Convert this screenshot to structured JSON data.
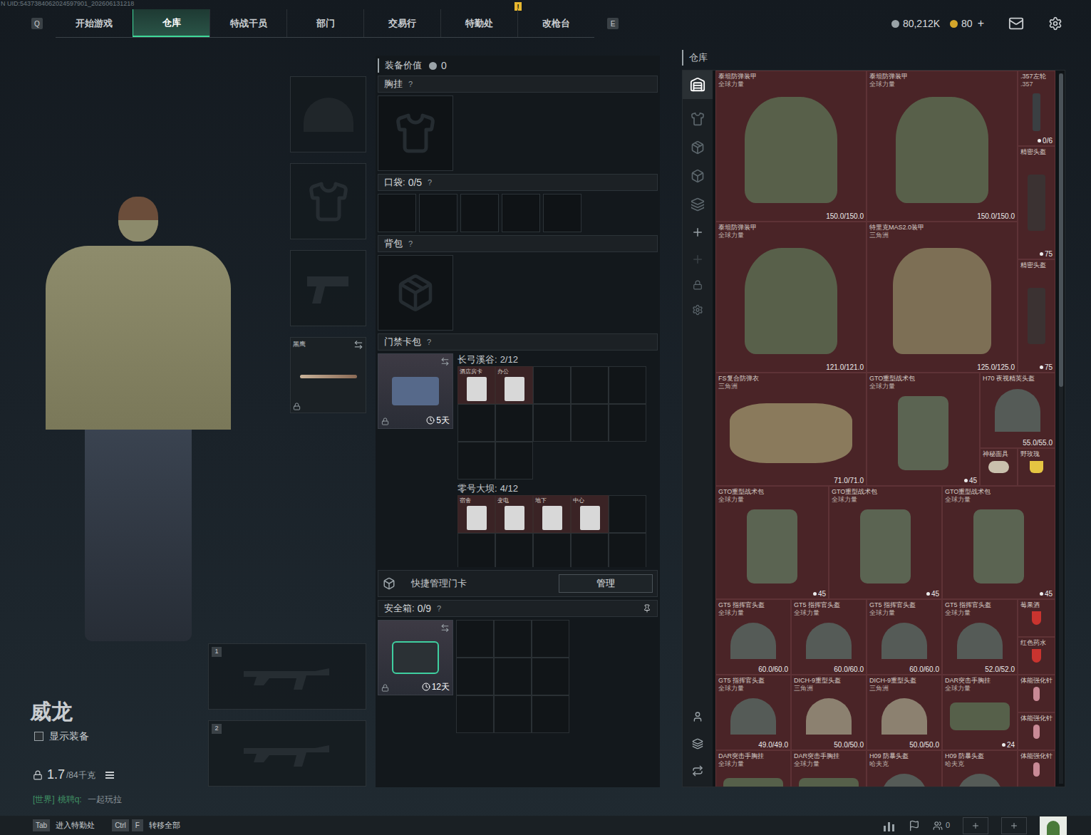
{
  "top_bar": {
    "uid": "N UID:5437384062024597901_202606131218",
    "prev_key": "Q",
    "next_key": "E",
    "tabs": [
      {
        "label": "开始游戏",
        "selected": false,
        "badge": ""
      },
      {
        "label": "仓库",
        "selected": true,
        "badge": ""
      },
      {
        "label": "特战干员",
        "selected": false,
        "badge": ""
      },
      {
        "label": "部门",
        "selected": false,
        "badge": ""
      },
      {
        "label": "交易行",
        "selected": false,
        "badge": ""
      },
      {
        "label": "特勤处",
        "selected": false,
        "badge": "!"
      },
      {
        "label": "改枪台",
        "selected": false,
        "badge": ""
      }
    ],
    "currency": "80,212K",
    "coins": "80",
    "coins_add": "+"
  },
  "character": {
    "name": "威龙",
    "show_equipment": {
      "label": "显示装备",
      "checked": false
    },
    "weight": "1.7",
    "weight_max": "/84千克"
  },
  "chat": {
    "channel": "[世界]",
    "user": "桃聘q:",
    "message": "一起玩拉"
  },
  "gear_slots": {
    "melee_label": "黑鹰",
    "weapon_slots": [
      "1",
      "2"
    ]
  },
  "loadout": {
    "value_label": "装备价值",
    "value": "0",
    "chest": {
      "label": "胸挂",
      "help": "?"
    },
    "pockets": {
      "label": "口袋:",
      "count": "0/5",
      "help": "?",
      "slots": 5
    },
    "backpack": {
      "label": "背包",
      "help": "?"
    },
    "keycards": {
      "label": "门禁卡包",
      "help": "?",
      "case_days": "5天",
      "maps": [
        {
          "name": "长弓溪谷:",
          "count": "2/12",
          "slots": 12,
          "cards": [
            "酒店房卡",
            "办公"
          ]
        },
        {
          "name": "零号大坝:",
          "count": "4/12",
          "slots": 12,
          "cards": [
            "宿舍",
            "变电",
            "地下",
            "中心"
          ]
        }
      ],
      "quick_manage": "快捷管理门卡",
      "manage_button": "管理"
    },
    "safebox": {
      "label": "安全箱:",
      "count": "0/9",
      "help": "?",
      "days": "12天",
      "slots": 9
    }
  },
  "warehouse": {
    "title": "仓库",
    "items": [
      {
        "name": "泰坦防弹装甲",
        "source": "全球力量",
        "durability": "150.0/150.0",
        "badge": "",
        "kind": "armor"
      },
      {
        "name": "泰坦防弹装甲",
        "source": "全球力量",
        "durability": "150.0/150.0",
        "badge": "",
        "kind": "armor"
      },
      {
        "name": ".357左轮",
        "source": ".357",
        "durability": "",
        "badge": "0/6",
        "kind": "revolver"
      },
      {
        "name": "精密头盔",
        "source": "",
        "durability": "",
        "badge": "75",
        "kind": "device"
      },
      {
        "name": "泰坦防弹装甲",
        "source": "全球力量",
        "durability": "121.0/121.0",
        "badge": "",
        "kind": "armor"
      },
      {
        "name": "特里克MAS2.0装甲",
        "source": "三角洲",
        "durability": "125.0/125.0",
        "badge": "",
        "kind": "vest"
      },
      {
        "name": "精密头盔",
        "source": "",
        "durability": "",
        "badge": "75",
        "kind": "device"
      },
      {
        "name": "FS复合防弹衣",
        "source": "三角洲",
        "durability": "71.0/71.0",
        "badge": "",
        "kind": "carrier"
      },
      {
        "name": "GTO重型战术包",
        "source": "全球力量",
        "durability": "",
        "badge": "45",
        "kind": "bag"
      },
      {
        "name": "H70 夜视精英头盔",
        "source": "",
        "durability": "55.0/55.0",
        "badge": "",
        "kind": "helmet"
      },
      {
        "name": "神秘面具",
        "source": "",
        "durability": "",
        "badge": "",
        "kind": "mask"
      },
      {
        "name": "野玫瑰",
        "source": "",
        "durability": "",
        "badge": "",
        "kind": "cocktail"
      },
      {
        "name": "GTO重型战术包",
        "source": "全球力量",
        "durability": "",
        "badge": "45",
        "kind": "bag"
      },
      {
        "name": "GTO重型战术包",
        "source": "全球力量",
        "durability": "",
        "badge": "45",
        "kind": "bag"
      },
      {
        "name": "GTO重型战术包",
        "source": "全球力量",
        "durability": "",
        "badge": "45",
        "kind": "bag"
      },
      {
        "name": "GT5 指挥官头盔",
        "source": "全球力量",
        "durability": "60.0/60.0",
        "badge": "",
        "kind": "helmet"
      },
      {
        "name": "GT5 指挥官头盔",
        "source": "全球力量",
        "durability": "60.0/60.0",
        "badge": "",
        "kind": "helmet"
      },
      {
        "name": "GT5 指挥官头盔",
        "source": "全球力量",
        "durability": "60.0/60.0",
        "badge": "",
        "kind": "helmet"
      },
      {
        "name": "GT5 指挥官头盔",
        "source": "全球力量",
        "durability": "52.0/52.0",
        "badge": "",
        "kind": "helmet"
      },
      {
        "name": "莓果酒",
        "source": "",
        "durability": "",
        "badge": "",
        "kind": "drink"
      },
      {
        "name": "红色药水",
        "source": "",
        "durability": "",
        "badge": "",
        "kind": "drink"
      },
      {
        "name": "GT5 指挥官头盔",
        "source": "全球力量",
        "durability": "49.0/49.0",
        "badge": "",
        "kind": "helmet"
      },
      {
        "name": "DICH-9重型头盔",
        "source": "三角洲",
        "durability": "50.0/50.0",
        "badge": "",
        "kind": "helmet_tan"
      },
      {
        "name": "DICH-9重型头盔",
        "source": "三角洲",
        "durability": "50.0/50.0",
        "badge": "",
        "kind": "helmet_tan"
      },
      {
        "name": "DAR突击手胸挂",
        "source": "全球力量",
        "durability": "",
        "badge": "24",
        "kind": "rig"
      },
      {
        "name": "体能强化针",
        "source": "",
        "durability": "",
        "badge": "",
        "kind": "injector"
      },
      {
        "name": "体能强化针",
        "source": "",
        "durability": "",
        "badge": "",
        "kind": "injector"
      },
      {
        "name": "DAR突击手胸挂",
        "source": "全球力量",
        "durability": "",
        "badge": "",
        "kind": "rig"
      },
      {
        "name": "DAR突击手胸挂",
        "source": "全球力量",
        "durability": "",
        "badge": "",
        "kind": "rig"
      },
      {
        "name": "H09 防暴头盔",
        "source": "哈夫克",
        "durability": "",
        "badge": "",
        "kind": "helmet"
      },
      {
        "name": "H09 防暴头盔",
        "source": "哈夫克",
        "durability": "",
        "badge": "",
        "kind": "helmet"
      },
      {
        "name": "体能强化针",
        "source": "",
        "durability": "",
        "badge": "",
        "kind": "injector"
      }
    ]
  },
  "hints": [
    {
      "keys": [
        "Tab"
      ],
      "label": "进入特勤处"
    },
    {
      "keys": [
        "Ctrl",
        "F"
      ],
      "label": "转移全部"
    }
  ],
  "footer": {
    "friends": "0"
  }
}
